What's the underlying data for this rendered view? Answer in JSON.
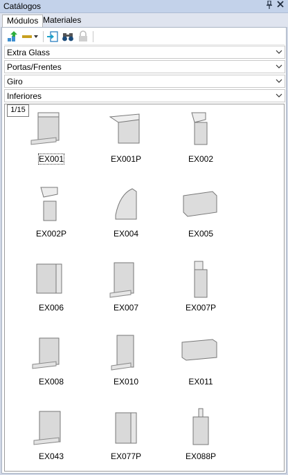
{
  "window": {
    "title": "Catálogos",
    "pin_icon": "pin-icon",
    "close_icon": "close-icon"
  },
  "tabs": [
    {
      "label": "Módulos",
      "active": true
    },
    {
      "label": "Materiales",
      "active": false
    }
  ],
  "toolbar": [
    "add-green-icon",
    "dash-dropdown-icon",
    "import-icon",
    "binoculars-icon",
    "lock-disabled-icon"
  ],
  "dropdowns": [
    {
      "value": "Extra Glass"
    },
    {
      "value": "Portas/Frentes"
    },
    {
      "value": "Giro"
    },
    {
      "value": "Inferiores"
    }
  ],
  "page_indicator": "1/15",
  "items": [
    {
      "code": "EX001",
      "selected": true
    },
    {
      "code": "EX001P"
    },
    {
      "code": "EX002"
    },
    {
      "code": "EX002P"
    },
    {
      "code": "EX004"
    },
    {
      "code": "EX005"
    },
    {
      "code": "EX006"
    },
    {
      "code": "EX007"
    },
    {
      "code": "EX007P"
    },
    {
      "code": "EX008"
    },
    {
      "code": "EX010"
    },
    {
      "code": "EX011"
    },
    {
      "code": "EX043"
    },
    {
      "code": "EX077P"
    },
    {
      "code": "EX088P"
    }
  ]
}
